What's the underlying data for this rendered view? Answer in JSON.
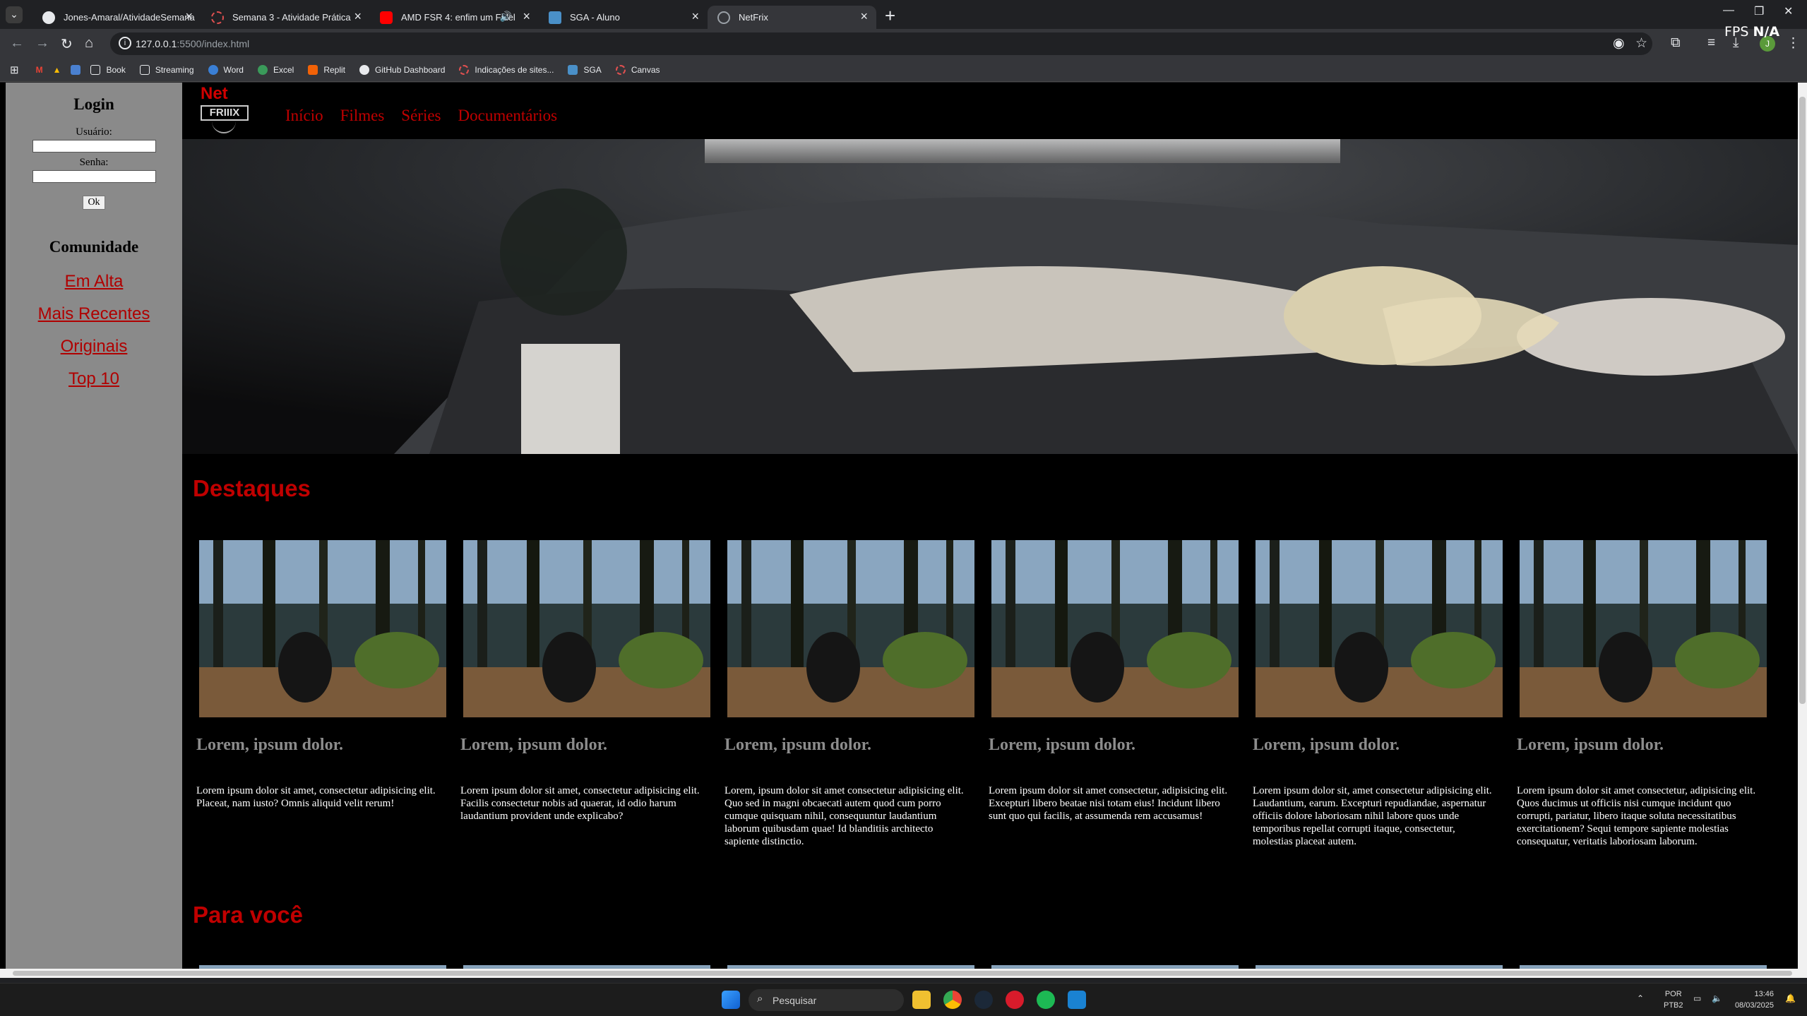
{
  "browser": {
    "tabs": [
      {
        "title": "Jones-Amaral/AtividadeSemana",
        "active": false
      },
      {
        "title": "Semana 3 - Atividade Prática",
        "active": false
      },
      {
        "title": "AMD FSR 4: enfim um Fidel",
        "active": false
      },
      {
        "title": "SGA - Aluno",
        "active": false
      },
      {
        "title": "NetFrix",
        "active": true
      }
    ],
    "address_host": "127.0.0.1",
    "address_path": ":5500/index.html",
    "bookmarks": [
      "Book",
      "Streaming",
      "Word",
      "Excel",
      "Replit",
      "GitHub Dashboard",
      "Indicações de sites...",
      "SGA",
      "Canvas"
    ],
    "fps_label": "FPS",
    "fps_value": "N/A",
    "avatar_letter": "J"
  },
  "sidebar": {
    "login_title": "Login",
    "user_label": "Usuário:",
    "pass_label": "Senha:",
    "ok_label": "Ok",
    "community_title": "Comunidade",
    "links": [
      "Em Alta",
      "Mais Recentes",
      "Originais",
      "Top 10"
    ]
  },
  "header": {
    "logo_top": "Net",
    "logo_bottom": "FRIIIX",
    "nav": [
      "Início",
      "Filmes",
      "Séries",
      "Documentários"
    ]
  },
  "sections": {
    "featured_title": "Destaques",
    "for_you_title": "Para você"
  },
  "cards": [
    {
      "title": "Lorem, ipsum dolor.",
      "text": "Lorem ipsum dolor sit amet, consectetur adipisicing elit. Placeat, nam iusto? Omnis aliquid velit rerum!"
    },
    {
      "title": "Lorem, ipsum dolor.",
      "text": "Lorem ipsum dolor sit amet, consectetur adipisicing elit. Facilis consectetur nobis ad quaerat, id odio harum laudantium provident unde explicabo?"
    },
    {
      "title": "Lorem, ipsum dolor.",
      "text": "Lorem, ipsum dolor sit amet consectetur adipisicing elit. Quo sed in magni obcaecati autem quod cum porro cumque quisquam nihil, consequuntur laudantium laborum quibusdam quae! Id blanditiis architecto sapiente distinctio."
    },
    {
      "title": "Lorem, ipsum dolor.",
      "text": "Lorem ipsum dolor sit amet consectetur, adipisicing elit. Excepturi libero beatae nisi totam eius! Incidunt libero sunt quo qui facilis, at assumenda rem accusamus!"
    },
    {
      "title": "Lorem, ipsum dolor.",
      "text": "Lorem ipsum dolor sit, amet consectetur adipisicing elit. Laudantium, earum. Excepturi repudiandae, aspernatur officiis dolore laboriosam nihil labore quos unde temporibus repellat corrupti itaque, consectetur, molestias placeat autem."
    },
    {
      "title": "Lorem, ipsum dolor.",
      "text": "Lorem ipsum dolor sit amet consectetur, adipisicing elit. Quos ducimus ut officiis nisi cumque incidunt quo corrupti, pariatur, libero itaque soluta necessitatibus exercitationem? Sequi tempore sapiente molestias consequatur, veritatis laboriosam laborum."
    }
  ],
  "taskbar": {
    "search_placeholder": "Pesquisar",
    "lang_top": "POR",
    "lang_bottom": "PTB2",
    "time": "13:46",
    "date": "08/03/2025"
  },
  "colors": {
    "accent_red": "#c00000",
    "sidebar_bg": "#8a8a8a",
    "page_bg": "#000000"
  }
}
